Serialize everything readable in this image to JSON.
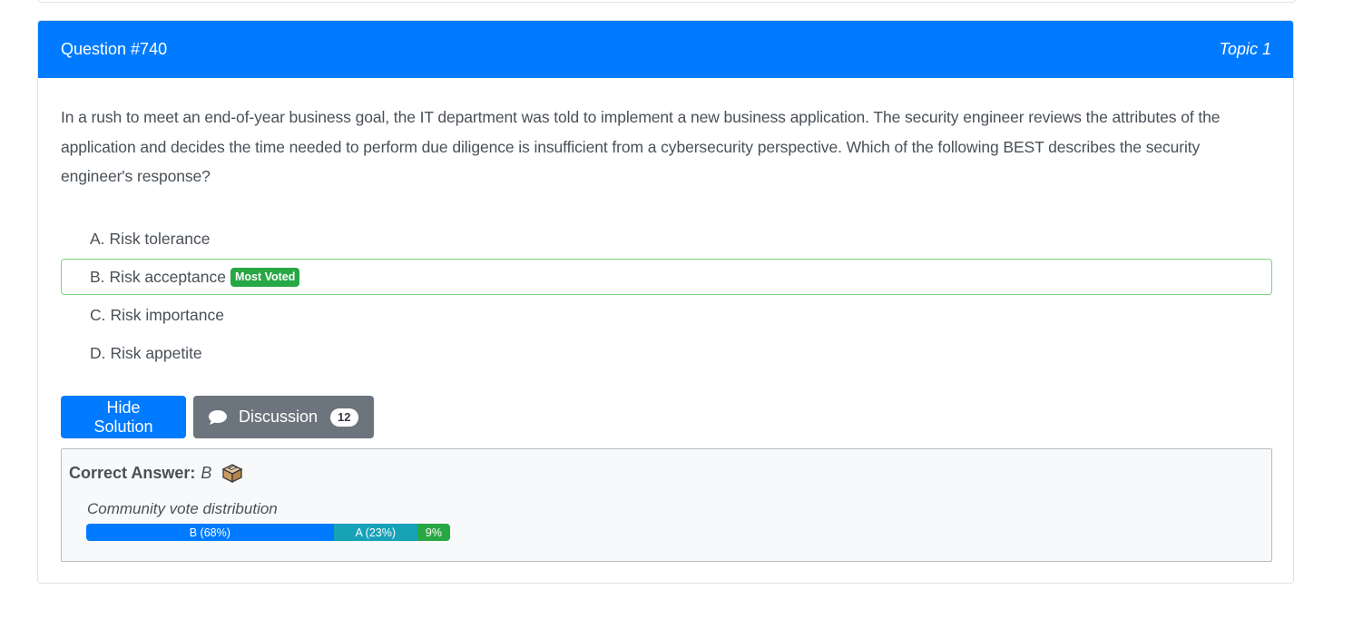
{
  "question": {
    "number_label": "Question #740",
    "topic_label": "Topic 1",
    "text": "In a rush to meet an end-of-year business goal, the IT department was told to implement a new business application. The security engineer reviews the attributes of the application and decides the time needed to perform due diligence is insufficient from a cybersecurity perspective. Which of the following BEST describes the security engineer's response?"
  },
  "choices": [
    {
      "letter": "A.",
      "text": "Risk tolerance",
      "badge": null
    },
    {
      "letter": "B.",
      "text": "Risk acceptance",
      "badge": "Most Voted"
    },
    {
      "letter": "C.",
      "text": "Risk importance",
      "badge": null
    },
    {
      "letter": "D.",
      "text": "Risk appetite",
      "badge": null
    }
  ],
  "actions": {
    "hide_solution_label": "Hide Solution",
    "discussion_label": "Discussion",
    "discussion_count": "12",
    "discussion_icon": "chat-bubble-icon"
  },
  "answer": {
    "label": "Correct Answer:",
    "value": "B",
    "icon": "ballot-box-icon",
    "vote_title": "Community vote distribution",
    "votes": [
      {
        "label": "B (68%)",
        "percent": 68,
        "color": "#007bff"
      },
      {
        "label": "A (23%)",
        "percent": 23,
        "color": "#17a2b8"
      },
      {
        "label": "9%",
        "percent": 9,
        "color": "#28a745"
      }
    ]
  }
}
